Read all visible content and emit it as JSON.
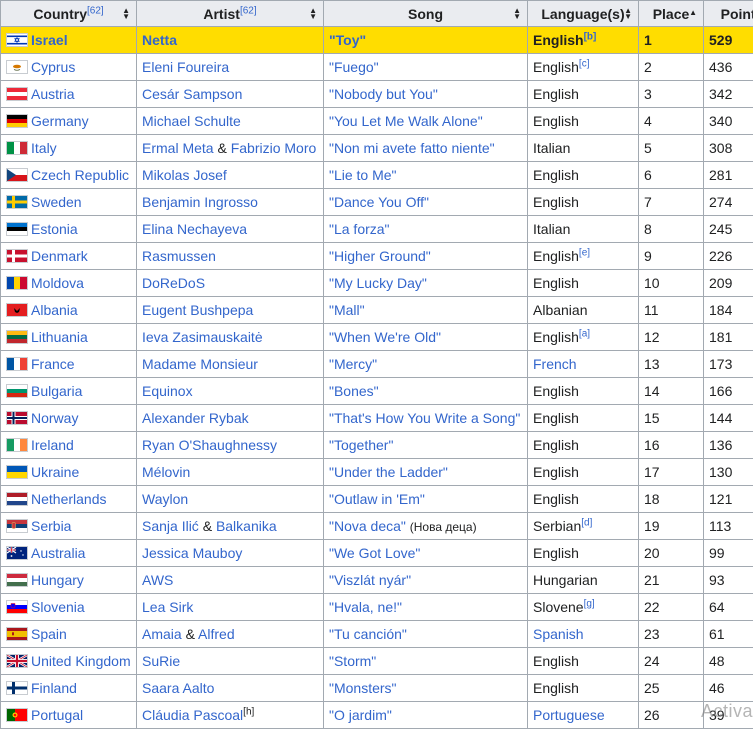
{
  "headers": [
    {
      "label": "Country",
      "ref": "[62]",
      "sort": "both"
    },
    {
      "label": "Artist",
      "ref": "[62]",
      "sort": "both"
    },
    {
      "label": "Song",
      "ref": "",
      "sort": "both"
    },
    {
      "label": "Language(s)",
      "ref": "",
      "sort": "both"
    },
    {
      "label": "Place",
      "ref": "",
      "sort": "up"
    },
    {
      "label": "Points",
      "ref": "",
      "sort": ""
    }
  ],
  "rows": [
    {
      "country": "Israel",
      "flag": "israel",
      "artist": "Netta",
      "song": "\"Toy\"",
      "lang": "English",
      "lang_ref": "[b]",
      "lang_link": false,
      "place": "1",
      "points": "529"
    },
    {
      "country": "Cyprus",
      "flag": "cyprus",
      "artist": "Eleni Foureira",
      "song": "\"Fuego\"",
      "lang": "English",
      "lang_ref": "[c]",
      "lang_link": false,
      "place": "2",
      "points": "436"
    },
    {
      "country": "Austria",
      "flag": "austria",
      "artist": "Cesár Sampson",
      "song": "\"Nobody but You\"",
      "lang": "English",
      "lang_ref": "",
      "lang_link": false,
      "place": "3",
      "points": "342"
    },
    {
      "country": "Germany",
      "flag": "germany",
      "artist": "Michael Schulte",
      "song": "\"You Let Me Walk Alone\"",
      "lang": "English",
      "lang_ref": "",
      "lang_link": false,
      "place": "4",
      "points": "340"
    },
    {
      "country": "Italy",
      "flag": "italy",
      "artist": "Ermal Meta & Fabrizio Moro",
      "artist_parts": [
        "Ermal Meta",
        " & ",
        "Fabrizio Moro"
      ],
      "song": "\"Non mi avete fatto niente\"",
      "lang": "Italian",
      "lang_ref": "",
      "lang_link": false,
      "place": "5",
      "points": "308"
    },
    {
      "country": "Czech Republic",
      "flag": "czech",
      "artist": "Mikolas Josef",
      "song": "\"Lie to Me\"",
      "lang": "English",
      "lang_ref": "",
      "lang_link": false,
      "place": "6",
      "points": "281"
    },
    {
      "country": "Sweden",
      "flag": "sweden",
      "artist": "Benjamin Ingrosso",
      "song": "\"Dance You Off\"",
      "lang": "English",
      "lang_ref": "",
      "lang_link": false,
      "place": "7",
      "points": "274"
    },
    {
      "country": "Estonia",
      "flag": "estonia",
      "artist": "Elina Nechayeva",
      "song": "\"La forza\"",
      "lang": "Italian",
      "lang_ref": "",
      "lang_link": false,
      "place": "8",
      "points": "245"
    },
    {
      "country": "Denmark",
      "flag": "denmark",
      "artist": "Rasmussen",
      "song": "\"Higher Ground\"",
      "lang": "English",
      "lang_ref": "[e]",
      "lang_link": false,
      "place": "9",
      "points": "226"
    },
    {
      "country": "Moldova",
      "flag": "moldova",
      "artist": "DoReDoS",
      "song": "\"My Lucky Day\"",
      "lang": "English",
      "lang_ref": "",
      "lang_link": false,
      "place": "10",
      "points": "209"
    },
    {
      "country": "Albania",
      "flag": "albania",
      "artist": "Eugent Bushpepa",
      "song": "\"Mall\"",
      "lang": "Albanian",
      "lang_ref": "",
      "lang_link": false,
      "place": "11",
      "points": "184"
    },
    {
      "country": "Lithuania",
      "flag": "lithuania",
      "artist": "Ieva Zasimauskaitė",
      "song": "\"When We're Old\"",
      "lang": "English",
      "lang_ref": "[a]",
      "lang_link": false,
      "place": "12",
      "points": "181"
    },
    {
      "country": "France",
      "flag": "france",
      "artist": "Madame Monsieur",
      "song": "\"Mercy\"",
      "lang": "French",
      "lang_ref": "",
      "lang_link": true,
      "place": "13",
      "points": "173"
    },
    {
      "country": "Bulgaria",
      "flag": "bulgaria",
      "artist": "Equinox",
      "song": "\"Bones\"",
      "lang": "English",
      "lang_ref": "",
      "lang_link": false,
      "place": "14",
      "points": "166"
    },
    {
      "country": "Norway",
      "flag": "norway",
      "artist": "Alexander Rybak",
      "song": "\"That's How You Write a Song\"",
      "lang": "English",
      "lang_ref": "",
      "lang_link": false,
      "place": "15",
      "points": "144"
    },
    {
      "country": "Ireland",
      "flag": "ireland",
      "artist": "Ryan O'Shaughnessy",
      "song": "\"Together\"",
      "lang": "English",
      "lang_ref": "",
      "lang_link": false,
      "place": "16",
      "points": "136"
    },
    {
      "country": "Ukraine",
      "flag": "ukraine",
      "artist": "Mélovin",
      "song": "\"Under the Ladder\"",
      "lang": "English",
      "lang_ref": "",
      "lang_link": false,
      "place": "17",
      "points": "130"
    },
    {
      "country": "Netherlands",
      "flag": "netherlands",
      "artist": "Waylon",
      "song": "\"Outlaw in 'Em\"",
      "lang": "English",
      "lang_ref": "",
      "lang_link": false,
      "place": "18",
      "points": "121"
    },
    {
      "country": "Serbia",
      "flag": "serbia",
      "artist": "Sanja Ilić & Balkanika",
      "artist_parts": [
        "Sanja Ilić",
        " & ",
        "Balkanika"
      ],
      "song": "\"Nova deca\"",
      "song_extra": "(Нова деца)",
      "lang": "Serbian",
      "lang_ref": "[d]",
      "lang_link": false,
      "place": "19",
      "points": "113"
    },
    {
      "country": "Australia",
      "flag": "australia",
      "artist": "Jessica Mauboy",
      "song": "\"We Got Love\"",
      "lang": "English",
      "lang_ref": "",
      "lang_link": false,
      "place": "20",
      "points": "99"
    },
    {
      "country": "Hungary",
      "flag": "hungary",
      "artist": "AWS",
      "song": "\"Viszlát nyár\"",
      "lang": "Hungarian",
      "lang_ref": "",
      "lang_link": false,
      "place": "21",
      "points": "93"
    },
    {
      "country": "Slovenia",
      "flag": "slovenia",
      "artist": "Lea Sirk",
      "song": "\"Hvala, ne!\"",
      "lang": "Slovene",
      "lang_ref": "[g]",
      "lang_link": false,
      "place": "22",
      "points": "64"
    },
    {
      "country": "Spain",
      "flag": "spain",
      "artist": "Amaia & Alfred",
      "artist_parts": [
        "Amaia",
        " & ",
        "Alfred"
      ],
      "song": "\"Tu canción\"",
      "lang": "Spanish",
      "lang_ref": "",
      "lang_link": true,
      "place": "23",
      "points": "61"
    },
    {
      "country": "United Kingdom",
      "flag": "uk",
      "artist": "SuRie",
      "song": "\"Storm\"",
      "lang": "English",
      "lang_ref": "",
      "lang_link": false,
      "place": "24",
      "points": "48"
    },
    {
      "country": "Finland",
      "flag": "finland",
      "artist": "Saara Aalto",
      "song": "\"Monsters\"",
      "lang": "English",
      "lang_ref": "",
      "lang_link": false,
      "place": "25",
      "points": "46"
    },
    {
      "country": "Portugal",
      "flag": "portugal",
      "artist": "Cláudia Pascoal",
      "artist_ref": "[h]",
      "song": "\"O jardim\"",
      "lang": "Portuguese",
      "lang_ref": "",
      "lang_link": true,
      "place": "26",
      "points": "39"
    }
  ],
  "watermark": "Activa"
}
